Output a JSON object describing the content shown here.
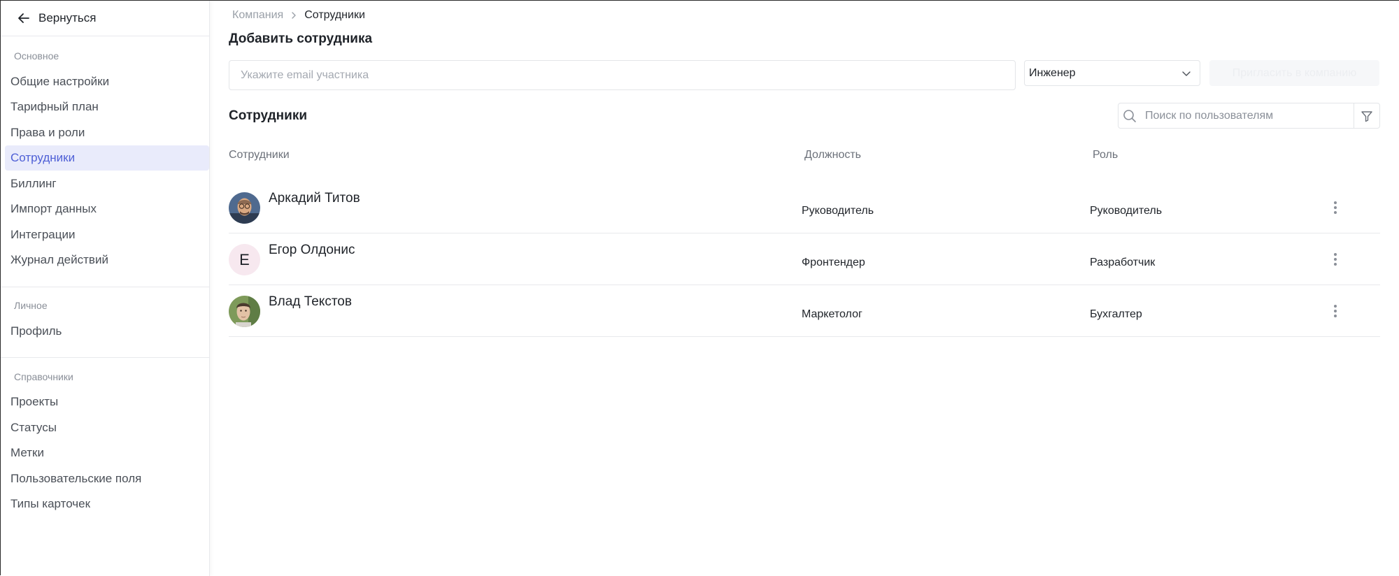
{
  "sidebar": {
    "back_label": "Вернуться",
    "sections": [
      {
        "label": "Основное",
        "items": [
          "Общие настройки",
          "Тарифный план",
          "Права и роли",
          "Сотрудники",
          "Биллинг",
          "Импорт данных",
          "Интеграции",
          "Журнал действий"
        ]
      },
      {
        "label": "Личное",
        "items": [
          "Профиль"
        ]
      },
      {
        "label": "Справочники",
        "items": [
          "Проекты",
          "Статусы",
          "Метки",
          "Пользовательские поля",
          "Типы карточек"
        ]
      }
    ],
    "active_item": "Сотрудники"
  },
  "breadcrumb": {
    "parent": "Компания",
    "current": "Сотрудники"
  },
  "add_section": {
    "title": "Добавить сотрудника",
    "email_placeholder": "Укажите email участника",
    "email_value": "",
    "role_selected": "Инженер",
    "invite_label": "Пригласить в компанию"
  },
  "staff_section": {
    "title": "Сотрудники",
    "search_placeholder": "Поиск по пользователям",
    "columns": {
      "employees": "Сотрудники",
      "position": "Должность",
      "role": "Роль"
    },
    "rows": [
      {
        "name": "Аркадий Титов",
        "position": "Руководитель",
        "role": "Руководитель",
        "avatar": "photo"
      },
      {
        "name": "Егор Олдонис",
        "position": "Фронтендер",
        "role": "Разработчик",
        "avatar": "letter",
        "initial": "Е"
      },
      {
        "name": "Влад Текстов",
        "position": "Маркетолог",
        "role": "Бухгалтер",
        "avatar": "photo"
      }
    ]
  },
  "icons": {
    "back": "arrow-left-icon",
    "breadcrumb_separator": "chevron-right-icon",
    "select": "chevron-down-icon",
    "search": "search-icon",
    "filter": "filter-icon",
    "row_menu": "kebab-icon"
  },
  "colors": {
    "accent": "#4e5fd6",
    "active_bg": "#e9ebfb",
    "border": "#e3e5e8",
    "muted_text": "#8a8f98"
  }
}
